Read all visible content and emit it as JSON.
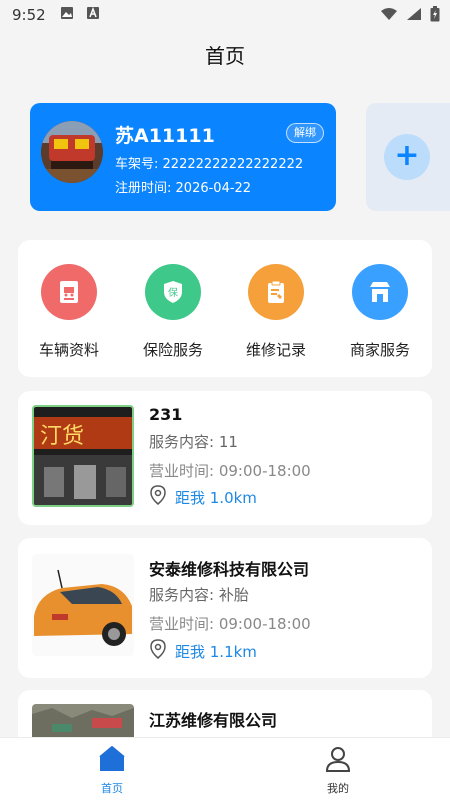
{
  "status_bar": {
    "time": "9:52"
  },
  "header": {
    "title": "首页"
  },
  "vehicle": {
    "plate": "苏A11111",
    "unbind_label": "解绑",
    "vin_label": "车架号:",
    "vin": "22222222222222222",
    "reg_label": "注册时间:",
    "reg_date": "2026-04-22"
  },
  "add_vehicle": {
    "label": "+"
  },
  "services": [
    {
      "label": "车辆资料",
      "color": "#f06a6a"
    },
    {
      "label": "保险服务",
      "color": "#3ec98a"
    },
    {
      "label": "维修记录",
      "color": "#f5a03a"
    },
    {
      "label": "商家服务",
      "color": "#3aa0ff"
    }
  ],
  "stores": [
    {
      "name": "231",
      "service_label": "服务内容:",
      "service": "11",
      "hours_label": "营业时间:",
      "hours": "09:00-18:00",
      "distance": "距我 1.0km"
    },
    {
      "name": "安泰维修科技有限公司",
      "service_label": "服务内容:",
      "service": "补胎",
      "hours_label": "营业时间:",
      "hours": "09:00-18:00",
      "distance": "距我 1.1km"
    },
    {
      "name": "江苏维修有限公司"
    }
  ],
  "tabs": [
    {
      "label": "首页",
      "active": true
    },
    {
      "label": "我的",
      "active": false
    }
  ],
  "colors": {
    "primary": "#0b84ff",
    "distance": "#1e88e5"
  }
}
